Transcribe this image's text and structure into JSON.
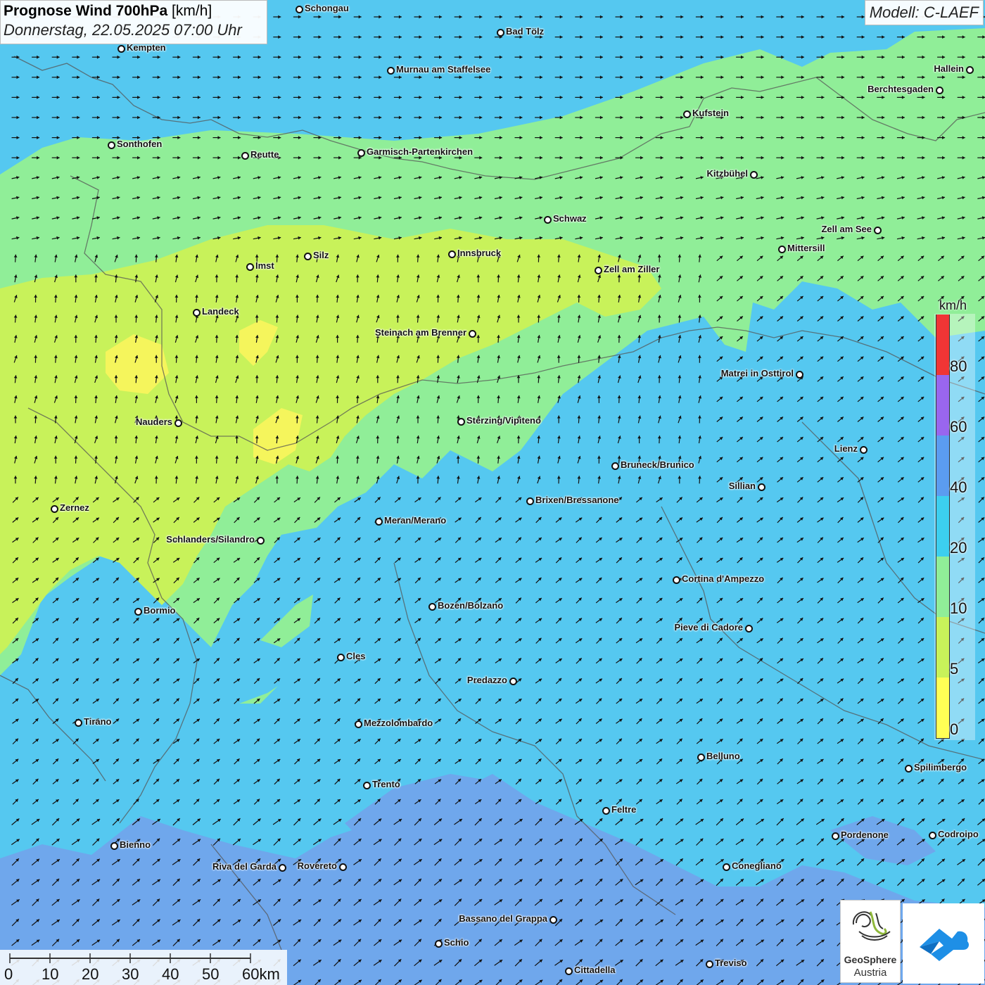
{
  "header": {
    "title_bold": "Prognose Wind 700hPa",
    "title_unit": "[km/h]",
    "subtitle": "Donnerstag, 22.05.2025 07:00 Uhr",
    "model": "Modell: C-LAEF"
  },
  "legend": {
    "unit": "km/h",
    "segments": [
      {
        "color": "#ffff55"
      },
      {
        "color": "#c8f25a"
      },
      {
        "color": "#90ee98"
      },
      {
        "color": "#3ccfef"
      },
      {
        "color": "#5b9cf0"
      },
      {
        "color": "#9966ee"
      },
      {
        "color": "#f03535"
      }
    ],
    "labels": [
      "0",
      "5",
      "10",
      "20",
      "40",
      "60",
      "80"
    ]
  },
  "scale": {
    "labels": [
      "0",
      "10",
      "20",
      "30",
      "40",
      "50",
      "60km"
    ]
  },
  "logos": {
    "geosphere_name": "GeoSphere",
    "geosphere_sub": "Austria"
  },
  "cities": [
    {
      "name": "Schongau"
    },
    {
      "name": "Bad Tölz"
    },
    {
      "name": "Kempten"
    },
    {
      "name": "Murnau am Staffelsee"
    },
    {
      "name": "Hallein"
    },
    {
      "name": "Berchtesgaden"
    },
    {
      "name": "Kufstein"
    },
    {
      "name": "Sonthofen"
    },
    {
      "name": "Reutte"
    },
    {
      "name": "Garmisch-Partenkirchen"
    },
    {
      "name": "Kitzbühel"
    },
    {
      "name": "Schwaz"
    },
    {
      "name": "Zell am See"
    },
    {
      "name": "Mittersill"
    },
    {
      "name": "Innsbruck"
    },
    {
      "name": "Silz"
    },
    {
      "name": "Imst"
    },
    {
      "name": "Zell am Ziller"
    },
    {
      "name": "Landeck"
    },
    {
      "name": "Steinach am Brenner"
    },
    {
      "name": "Matrei in Osttirol"
    },
    {
      "name": "Nauders"
    },
    {
      "name": "Sterzing/Vipiteno"
    },
    {
      "name": "Lienz"
    },
    {
      "name": "Bruneck/Brunico"
    },
    {
      "name": "Sillian"
    },
    {
      "name": "Zernez"
    },
    {
      "name": "Brixen/Bressanone"
    },
    {
      "name": "Meran/Merano"
    },
    {
      "name": "Schlanders/Silandro"
    },
    {
      "name": "Cortina d'Ampezzo"
    },
    {
      "name": "Bormio"
    },
    {
      "name": "Bozen/Bolzano"
    },
    {
      "name": "Pieve di Cadore"
    },
    {
      "name": "Cles"
    },
    {
      "name": "Predazzo"
    },
    {
      "name": "Tirano"
    },
    {
      "name": "Mezzolombardo"
    },
    {
      "name": "Belluno"
    },
    {
      "name": "Spilimbergo"
    },
    {
      "name": "Trento"
    },
    {
      "name": "Feltre"
    },
    {
      "name": "Pordenone"
    },
    {
      "name": "Codroipo"
    },
    {
      "name": "Bienno"
    },
    {
      "name": "Riva del Garda"
    },
    {
      "name": "Rovereto"
    },
    {
      "name": "Conegliano"
    },
    {
      "name": "Bassano del Grappa"
    },
    {
      "name": "Schio"
    },
    {
      "name": "Treviso"
    },
    {
      "name": "Cittadella"
    }
  ]
}
